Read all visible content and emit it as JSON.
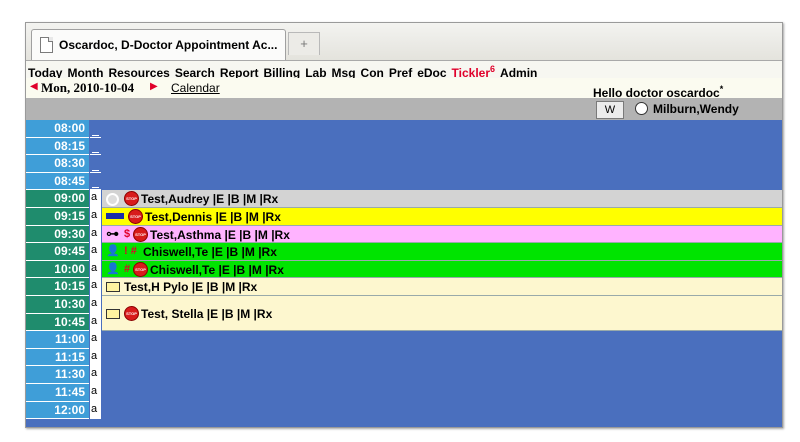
{
  "tab": {
    "title": "Oscardoc, D-Doctor Appointment Ac...",
    "new_tab": "+"
  },
  "menu": [
    {
      "label": "Today"
    },
    {
      "label": "Month"
    },
    {
      "label": "Resources"
    },
    {
      "label": "Search"
    },
    {
      "label": "Report"
    },
    {
      "label": "Billing"
    },
    {
      "label": "Lab"
    },
    {
      "label": "Msg"
    },
    {
      "label": "Con"
    },
    {
      "label": "Pref"
    },
    {
      "label": "eDoc"
    },
    {
      "label": "Tickler",
      "badge": "6"
    },
    {
      "label": "Admin"
    }
  ],
  "nav": {
    "date": "Mon, 2010-10-04",
    "calendar": "Calendar",
    "greeting": "Hello doctor oscardoc",
    "greeting_mark": "*"
  },
  "provider": {
    "view_button": "W",
    "name": "Milburn,Wendy"
  },
  "colors": {
    "time_dark": "#1f8c6d",
    "time_light": "#3f9ed8",
    "grid": "#4a6fbe"
  },
  "times": [
    "08:00",
    "08:15",
    "08:30",
    "08:45",
    "09:00",
    "09:15",
    "09:30",
    "09:45",
    "10:00",
    "10:15",
    "10:30",
    "10:45",
    "11:00",
    "11:15",
    "11:30",
    "11:45",
    "12:00"
  ],
  "slot_marks": [
    "",
    "",
    "",
    "",
    "a",
    "a",
    "a",
    "a",
    "a",
    "a",
    "a",
    "a",
    "a",
    "a",
    "a",
    "a",
    "a"
  ],
  "appointments": [
    {
      "time": "09:00",
      "icons": "circle,stop",
      "status": "",
      "name": "Test,Audrey |E |B |M |Rx",
      "color": "#d3d3d3"
    },
    {
      "time": "09:15",
      "icons": "bar,stop",
      "status": "",
      "name": "Test,Dennis |E |B |M |Rx",
      "color": "#ffff00"
    },
    {
      "time": "09:30",
      "icons": "arrow,stop",
      "status": "$",
      "name": "Test,Asthma |E |B |M |Rx",
      "color": "#ffb3ff"
    },
    {
      "time": "09:45",
      "icons": "person",
      "status": "! #",
      "name": "Chiswell,Te |E |B |M |Rx",
      "color": "#00e400"
    },
    {
      "time": "10:00",
      "icons": "person,stop",
      "status": "#",
      "name": "Chiswell,Te |E |B |M |Rx",
      "color": "#00e400"
    },
    {
      "time": "10:15",
      "icons": "folder",
      "status": "",
      "name": "Test,H Pylo |E |B |M |Rx",
      "color": "#fdf7cf"
    },
    {
      "time": "10:30",
      "icons": "folder,stop",
      "status": "",
      "name": "Test, Stella |E |B |M |Rx",
      "color": "#fdf7cf"
    }
  ]
}
